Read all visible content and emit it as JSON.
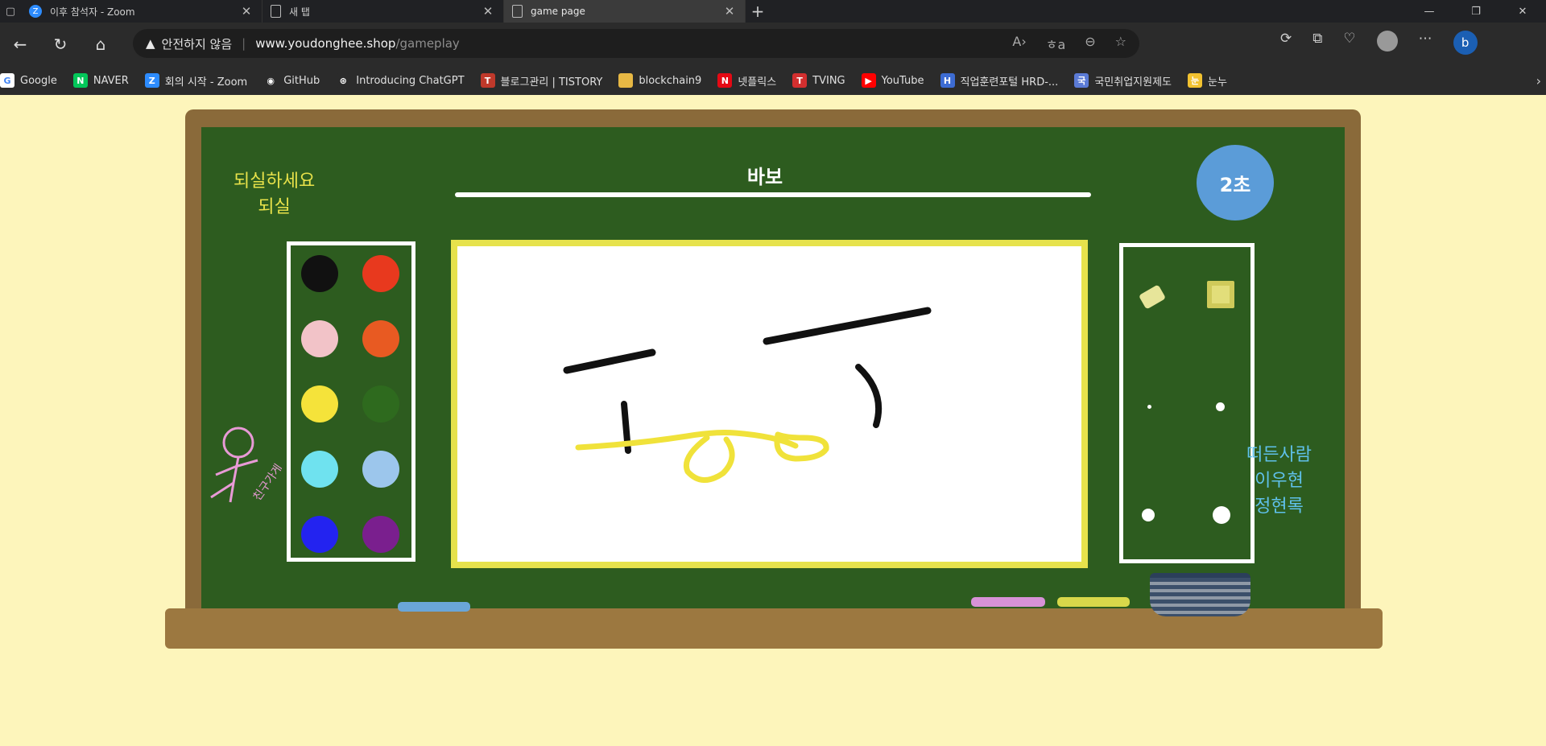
{
  "browser": {
    "tabs": [
      {
        "title": "이후 참석자 - Zoom",
        "icon": "zoom-icon",
        "icon_letter": "Z",
        "active": false
      },
      {
        "title": "새 탭",
        "icon": "new-tab-icon",
        "icon_letter": "",
        "active": false
      },
      {
        "title": "game page",
        "icon": "page-icon",
        "icon_letter": "",
        "active": true
      }
    ],
    "address": {
      "warning_text": "안전하지 않음",
      "host": "www.youdonghee.shop",
      "path": "/gameplay"
    },
    "bookmarks": [
      {
        "label": "Google",
        "icon": "google-icon",
        "letter": "G",
        "color": "#ffffff"
      },
      {
        "label": "NAVER",
        "icon": "naver-icon",
        "letter": "N",
        "color": "#03c75a"
      },
      {
        "label": "회의 시작 - Zoom",
        "icon": "zoom-icon",
        "letter": "Z",
        "color": "#2d8cff"
      },
      {
        "label": "GitHub",
        "icon": "github-icon",
        "letter": "◉",
        "color": "#2b2b2b"
      },
      {
        "label": "Introducing ChatGPT",
        "icon": "chatgpt-icon",
        "letter": "⊛",
        "color": "#2b2b2b"
      },
      {
        "label": "블로그관리 | TISTORY",
        "icon": "tistory-icon",
        "letter": "T",
        "color": "#c0392b"
      },
      {
        "label": "blockchain9",
        "icon": "folder-icon",
        "letter": "",
        "color": "#e7b844"
      },
      {
        "label": "넷플릭스",
        "icon": "netflix-icon",
        "letter": "N",
        "color": "#e50914"
      },
      {
        "label": "TVING",
        "icon": "tving-icon",
        "letter": "T",
        "color": "#d32f2f"
      },
      {
        "label": "YouTube",
        "icon": "youtube-icon",
        "letter": "▶",
        "color": "#ff0000"
      },
      {
        "label": "직업훈련포털 HRD-...",
        "icon": "hrd-icon",
        "letter": "H",
        "color": "#3d6cd3"
      },
      {
        "label": "국민취업지원제도",
        "icon": "employment-icon",
        "letter": "국",
        "color": "#5b7bd6"
      },
      {
        "label": "눈누",
        "icon": "noonnu-icon",
        "letter": "눈",
        "color": "#f2c230"
      }
    ]
  },
  "game": {
    "corner_note_line1": "되실하세요",
    "corner_note_line2": "되실",
    "word": "바보",
    "timer": "2초",
    "palette": [
      "#111111",
      "#e8391e",
      "#f2c3c8",
      "#e85a22",
      "#f5e33a",
      "#2e6a1e",
      "#6fe2ef",
      "#9cc6ec",
      "#2323f0",
      "#7a1f8e"
    ],
    "players_title": "떠든사람",
    "players": [
      "이우현",
      "정현록"
    ],
    "stick_caption": "친구가게",
    "chalk_colors": [
      "#6aa6d8",
      "#d792d7",
      "#d8d84a"
    ]
  }
}
